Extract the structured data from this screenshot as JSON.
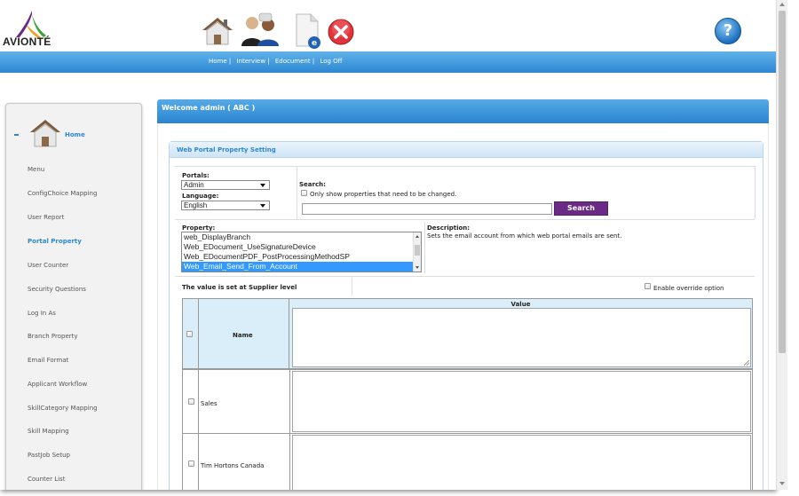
{
  "brand": {
    "logo_text": "AVIONTÉ"
  },
  "header": {
    "icons": [
      "home-icon",
      "interview-icon",
      "edocument-icon",
      "logoff-icon",
      "help-icon"
    ],
    "help_glyph": "?"
  },
  "nav": {
    "home": "Home |",
    "interview": "Interview |",
    "edocument": "Edocument |",
    "logoff": "Log Off"
  },
  "sidebar": {
    "home_label": "Home",
    "items": [
      {
        "label": "Menu"
      },
      {
        "label": "ConfigChoice Mapping"
      },
      {
        "label": "User Report"
      },
      {
        "label": "Portal Property"
      },
      {
        "label": "User Counter"
      },
      {
        "label": "Security Questions"
      },
      {
        "label": "Log In As"
      },
      {
        "label": "Branch Property"
      },
      {
        "label": "Email Format"
      },
      {
        "label": "Applicant Workflow"
      },
      {
        "label": "SkillCategory Mapping"
      },
      {
        "label": "Skill Mapping"
      },
      {
        "label": "PastJob Setup"
      },
      {
        "label": "Counter List"
      }
    ],
    "active_item": "Portal Property"
  },
  "welcome": {
    "text": "Welcome admin ( ABC )"
  },
  "panel": {
    "title": "Web Portal Property Setting",
    "portals_label": "Portals:",
    "portals_value": "Admin",
    "language_label": "Language:",
    "language_value": "English",
    "search_label": "Search:",
    "only_show_label": "Only show properties that need to be changed.",
    "search_value": "",
    "search_button": "Search",
    "property_label": "Property:",
    "properties": [
      "web_DisplayBranch",
      "Web_EDocument_UseSignatureDevice",
      "Web_EDocumentPDF_PostProcessingMethodSP",
      "Web_Email_Send_From_Account"
    ],
    "selected_property": "Web_Email_Send_From_Account",
    "description_label": "Description:",
    "description_text": "Sets the email account from which web portal emails are sent.",
    "level_text": "The value is set at Supplier level",
    "override_label": "Enable override option"
  },
  "table": {
    "name_header": "Name",
    "value_header": "Value",
    "rows": [
      {
        "name": "Sales",
        "value": ""
      },
      {
        "name": "Tim Hortons Canada",
        "value": ""
      }
    ]
  },
  "colors": {
    "accent_blue": "#2d87d0",
    "search_button": "#6a2a86",
    "header_cell": "#d9eef8",
    "selected_option": "#3399ff"
  }
}
